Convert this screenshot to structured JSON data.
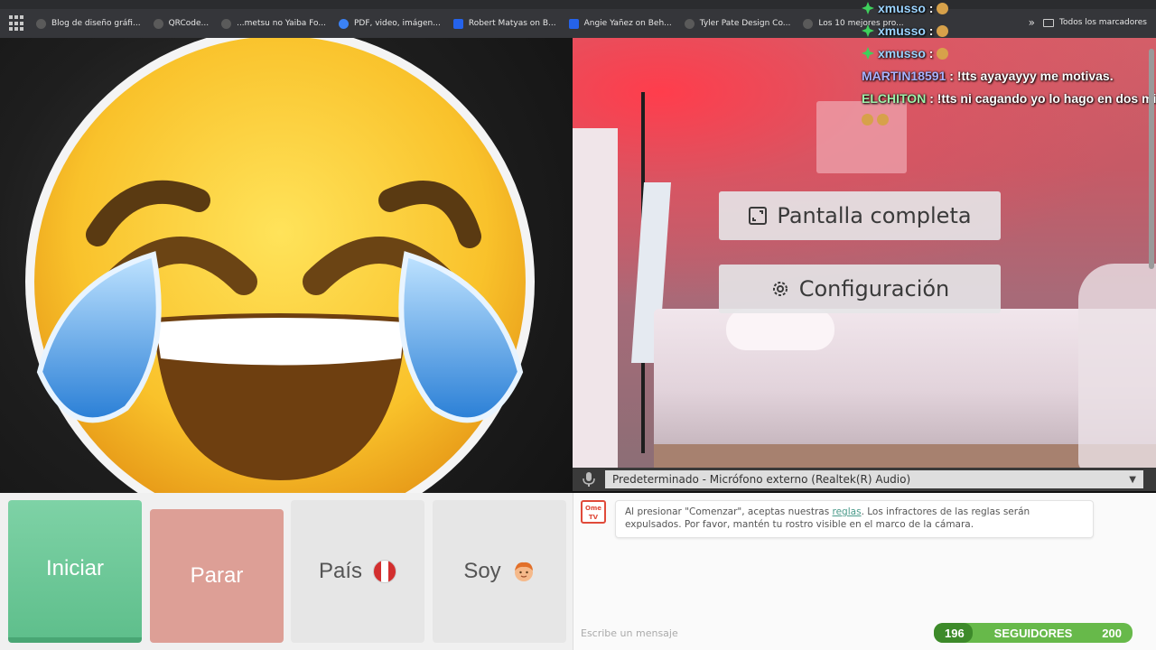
{
  "browser": {
    "bookmarks": [
      {
        "label": "Blog de diseño gráfi...",
        "icon": "site-icon"
      },
      {
        "label": "QRCode...",
        "icon": "qr-icon"
      },
      {
        "label": "...metsu no Yaiba Fo...",
        "icon": "site-icon"
      },
      {
        "label": "PDF, video, imágen...",
        "icon": "blue-icon"
      },
      {
        "label": "Robert Matyas on B...",
        "icon": "behance-icon"
      },
      {
        "label": "Angie Yañez on Beh...",
        "icon": "behance-icon"
      },
      {
        "label": "Tyler Pate Design Co...",
        "icon": "site-icon"
      },
      {
        "label": "Los 10 mejores pro...",
        "icon": "site-icon"
      }
    ],
    "more": "»",
    "all_bookmarks": "Todos los marcadores"
  },
  "chat": [
    {
      "user": "xmusso",
      "message": "",
      "badge": "star-icon",
      "user_color": "#9bd3ff"
    },
    {
      "user": "xmusso",
      "message": "",
      "badge": "star-icon",
      "user_color": "#9bd3ff"
    },
    {
      "user": "xmusso",
      "message": "",
      "badge": "star-icon",
      "user_color": "#9bd3ff"
    },
    {
      "user": "MARTIN18591",
      "message": "!tts ayayayyy me motivas.",
      "user_color": "#a9b2ff"
    },
    {
      "user": "ELCHITON",
      "message": "!tts ni cagando yo lo hago en dos mi",
      "user_color": "#9ef0a9"
    }
  ],
  "overlay": {
    "fullscreen_label": "Pantalla completa",
    "settings_label": "Configuración"
  },
  "mic": {
    "selected": "Predeterminado - Micrófono externo (Realtek(R) Audio)"
  },
  "controls": {
    "start": "Iniciar",
    "stop": "Parar",
    "country": "País",
    "me": "Soy"
  },
  "notice": {
    "logo_top": "Ome",
    "logo_bottom": "TV",
    "before": "Al presionar \"Comenzar\", aceptas nuestras ",
    "link": "reglas",
    "after": ". Los infractores de las reglas serán expulsados. Por favor, mantén tu rostro visible en el marco de la cámara."
  },
  "message_input": {
    "placeholder": "Escribe un mensaje"
  },
  "followers": {
    "current": "196",
    "label": "SEGUIDORES",
    "goal": "200",
    "progress_fraction": 0.98
  },
  "colors": {
    "start": "#5fbf8c",
    "stop": "#dd9f96",
    "followers_bar": "#67b94a"
  }
}
